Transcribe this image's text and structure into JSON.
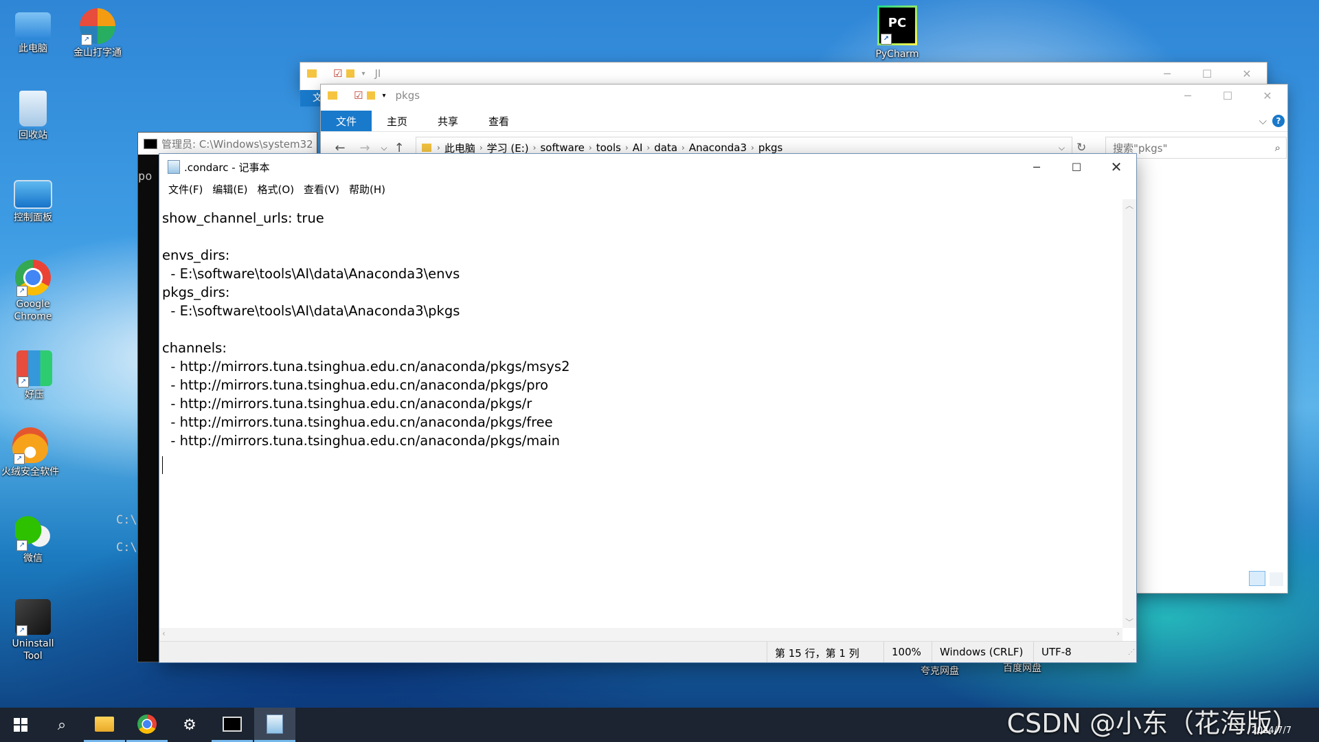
{
  "desktop_icons": [
    {
      "id": "this-pc",
      "label": "此电脑"
    },
    {
      "id": "kingsoft",
      "label": "金山打字通"
    },
    {
      "id": "recycle",
      "label": "回收站"
    },
    {
      "id": "control-panel",
      "label": "控制面板"
    },
    {
      "id": "chrome",
      "label": "Google Chrome"
    },
    {
      "id": "haozip",
      "label": "好压"
    },
    {
      "id": "huorong",
      "label": "火绒安全软件"
    },
    {
      "id": "wechat",
      "label": "微信"
    },
    {
      "id": "uninstall",
      "label": "Uninstall Tool"
    },
    {
      "id": "pycharm",
      "label": "PyCharm",
      "badge": "PC"
    },
    {
      "id": "kuake",
      "label": "夸克网盘"
    },
    {
      "id": "baidu",
      "label": "百度网盘"
    }
  ],
  "cmd": {
    "title": "管理员: C:\\Windows\\system32",
    "lines": [
      "po",
      "C:\\",
      "C:\\"
    ]
  },
  "explorer_back": {
    "title": "JI",
    "tab_label": "文"
  },
  "explorer": {
    "title": "pkgs",
    "tabs": [
      "文件",
      "主页",
      "共享",
      "查看"
    ],
    "path": [
      "此电脑",
      "学习 (E:)",
      "software",
      "tools",
      "AI",
      "data",
      "Anaconda3",
      "pkgs"
    ],
    "search_placeholder": "搜索\"pkgs\""
  },
  "notepad": {
    "title": ".condarc - 记事本",
    "menu": [
      "文件(F)",
      "编辑(E)",
      "格式(O)",
      "查看(V)",
      "帮助(H)"
    ],
    "content": "show_channel_urls: true\n\nenvs_dirs:\n  - E:\\software\\tools\\AI\\data\\Anaconda3\\envs\npkgs_dirs:\n  - E:\\software\\tools\\AI\\data\\Anaconda3\\pkgs\n\nchannels:\n  - http://mirrors.tuna.tsinghua.edu.cn/anaconda/pkgs/msys2\n  - http://mirrors.tuna.tsinghua.edu.cn/anaconda/pkgs/pro\n  - http://mirrors.tuna.tsinghua.edu.cn/anaconda/pkgs/r\n  - http://mirrors.tuna.tsinghua.edu.cn/anaconda/pkgs/free\n  - http://mirrors.tuna.tsinghua.edu.cn/anaconda/pkgs/main\n",
    "status": {
      "position": "第 15 行，第 1 列",
      "zoom": "100%",
      "line_ending": "Windows (CRLF)",
      "encoding": "UTF-8"
    }
  },
  "watermark": "CSDN @小东（花海版）",
  "clock_date": "2024/7/7"
}
